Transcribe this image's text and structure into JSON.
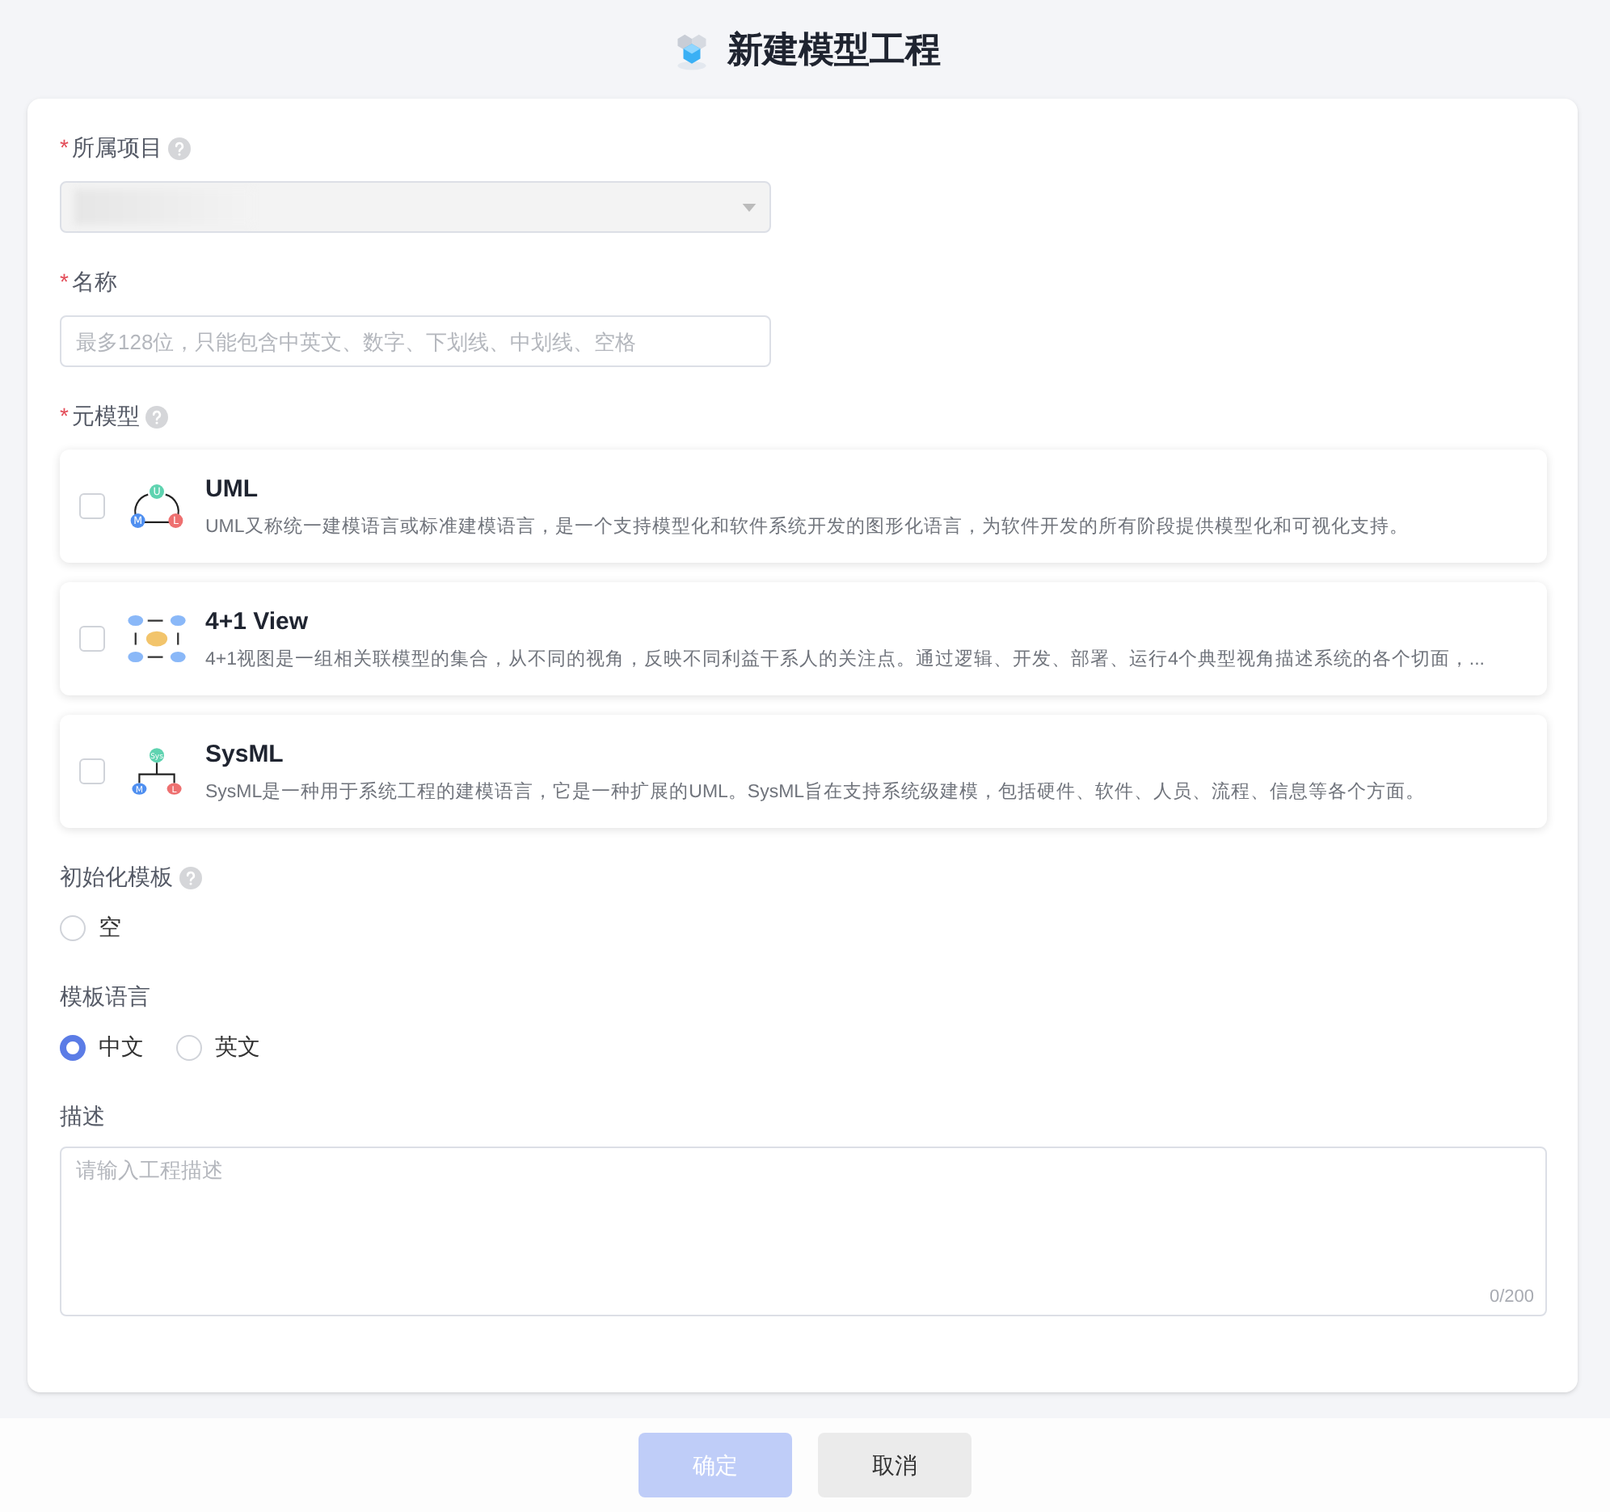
{
  "header": {
    "title": "新建模型工程"
  },
  "project": {
    "label": "所属项目",
    "required_mark": "*",
    "help": true,
    "disabled": true
  },
  "name": {
    "label": "名称",
    "required_mark": "*",
    "placeholder": "最多128位，只能包含中英文、数字、下划线、中划线、空格"
  },
  "metamodel": {
    "label": "元模型",
    "required_mark": "*",
    "help": true,
    "options": [
      {
        "kind": "uml",
        "icon_letters": [
          "U",
          "M",
          "L"
        ],
        "title": "UML",
        "description": "UML又称统一建模语言或标准建模语言，是一个支持模型化和软件系统开发的图形化语言，为软件开发的所有阶段提供模型化和可视化支持。",
        "checked": false
      },
      {
        "kind": "view41",
        "title": "4+1 View",
        "description": "4+1视图是一组相关联模型的集合，从不同的视角，反映不同利益干系人的关注点。通过逻辑、开发、部署、运行4个典型视角描述系统的各个切面，...",
        "checked": false
      },
      {
        "kind": "sysml",
        "icon_letters": [
          "Sys",
          "M",
          "L"
        ],
        "title": "SysML",
        "description": "SysML是一种用于系统工程的建模语言，它是一种扩展的UML。SysML旨在支持系统级建模，包括硬件、软件、人员、流程、信息等各个方面。",
        "checked": false
      }
    ]
  },
  "template": {
    "label": "初始化模板",
    "help": true,
    "options": [
      {
        "label": "空",
        "selected": false
      }
    ]
  },
  "language": {
    "label": "模板语言",
    "options": [
      {
        "label": "中文",
        "selected": true
      },
      {
        "label": "英文",
        "selected": false
      }
    ]
  },
  "description": {
    "label": "描述",
    "placeholder": "请输入工程描述",
    "counter": "0/200"
  },
  "footer": {
    "buttons": [
      {
        "label": "确定",
        "kind": "primary",
        "disabled": true
      },
      {
        "label": "取消",
        "kind": "default",
        "disabled": false
      }
    ]
  }
}
